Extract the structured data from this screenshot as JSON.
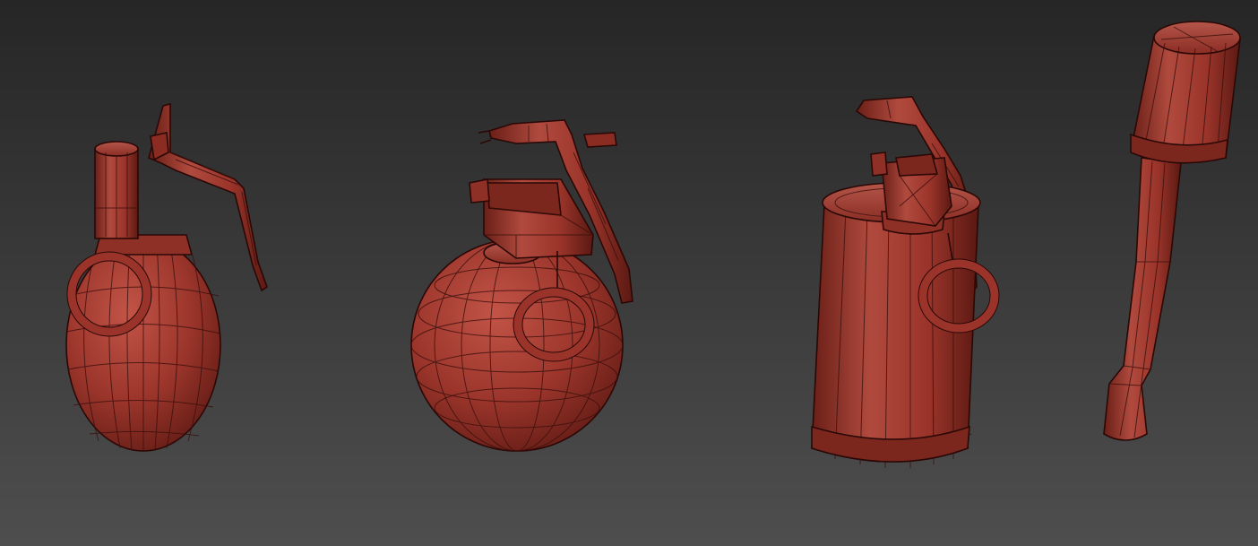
{
  "viewport": {
    "background_top": "#262626",
    "background_bottom": "#4e4e4e",
    "model_color": "#a13a30",
    "wireframe_color": "#3a0f0c"
  },
  "models": [
    {
      "name": "pineapple-grenade"
    },
    {
      "name": "spherical-grenade"
    },
    {
      "name": "cylindrical-grenade"
    },
    {
      "name": "stick-grenade"
    }
  ]
}
